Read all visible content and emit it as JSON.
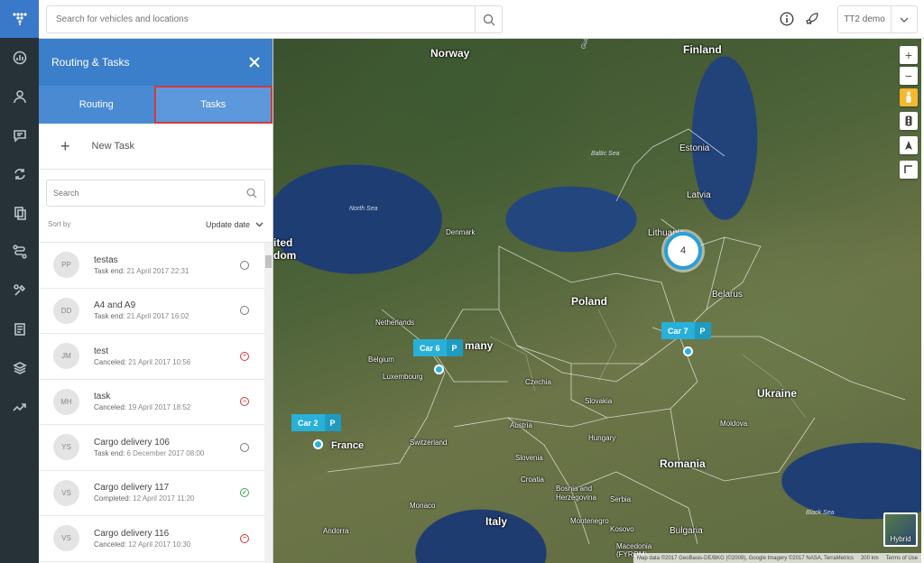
{
  "topbar": {
    "search_placeholder": "Search for vehicles and locations",
    "account_name": "TT2 demo"
  },
  "rail": {
    "items": [
      "dashboard-icon",
      "user-icon",
      "chat-icon",
      "sync-icon",
      "document-icon",
      "route-icon",
      "tasks-icon",
      "reports-icon",
      "layers-icon",
      "trend-icon"
    ]
  },
  "panel": {
    "title": "Routing & Tasks",
    "tabs": [
      "Routing",
      "Tasks"
    ],
    "active_tab": "Tasks",
    "new_task_label": "New Task",
    "search_placeholder": "Search",
    "sort_label": "Sort by",
    "sort_value": "Update date",
    "tasks": [
      {
        "initials": "PP",
        "name": "testas",
        "status_label": "Task end:",
        "date": "21 April 2017 22:31",
        "status": "open"
      },
      {
        "initials": "DD",
        "name": "A4 and A9",
        "status_label": "Task end:",
        "date": "21 April 2017 16:02",
        "status": "open"
      },
      {
        "initials": "JM",
        "name": "test",
        "status_label": "Canceled:",
        "date": "21 April 2017 10:56",
        "status": "canceled"
      },
      {
        "initials": "MH",
        "name": "task",
        "status_label": "Canceled:",
        "date": "19 April 2017 18:52",
        "status": "canceled"
      },
      {
        "initials": "YS",
        "name": "Cargo delivery 106",
        "status_label": "Task end:",
        "date": "6 December 2017 08:00",
        "status": "open"
      },
      {
        "initials": "VS",
        "name": "Cargo delivery 117",
        "status_label": "Completed:",
        "date": "12 April 2017 11:20",
        "status": "completed"
      },
      {
        "initials": "VS",
        "name": "Cargo delivery 116",
        "status_label": "Canceled:",
        "date": "12 April 2017 10:30",
        "status": "canceled"
      }
    ]
  },
  "map": {
    "labels": {
      "norway": "Norway",
      "finland": "Finland",
      "estonia": "Estonia",
      "latvia": "Latvia",
      "lithuania": "Lithuania",
      "belarus": "Belarus",
      "poland": "Poland",
      "ukraine": "Ukraine",
      "denmark": "Denmark",
      "netherlands": "Netherlands",
      "belgium": "Belgium",
      "luxembourg": "Luxembourg",
      "germany": "many",
      "czechia": "Czechia",
      "slovakia": "Slovakia",
      "austria": "Austria",
      "hungary": "Hungary",
      "moldova": "Moldova",
      "romania": "Romania",
      "switzerland": "Switzerland",
      "slovenia": "Slovenia",
      "croatia": "Croatia",
      "bosnia": "Bosnia and\nHerzegovina",
      "serbia": "Serbia",
      "bulgaria": "Bulgaria",
      "montenegro": "Montenegro",
      "kosovo": "Kosovo",
      "macedonia": "Macedonia\n(FYROM)",
      "italy": "Italy",
      "france": "France",
      "monaco": "Monaco",
      "andorra": "Andorra",
      "uk1": "ited",
      "uk2": "dom",
      "north_sea": "North Sea",
      "baltic_sea": "Baltic Sea",
      "black_sea": "Black Sea",
      "gulf": "Gulf of Bothnia"
    },
    "cars": [
      {
        "name": "Car 6",
        "badge": "P"
      },
      {
        "name": "Car 7",
        "badge": "P"
      },
      {
        "name": "Car 2",
        "badge": "P"
      }
    ],
    "cluster_count": "4",
    "hybrid_label": "Hybrid",
    "attribution": "Map data ©2017 GeoBasis-DE/BKG (©2009), Google Imagery ©2017 NASA, TerraMetrics",
    "scale": "200 km",
    "terms": "Terms of Use"
  }
}
